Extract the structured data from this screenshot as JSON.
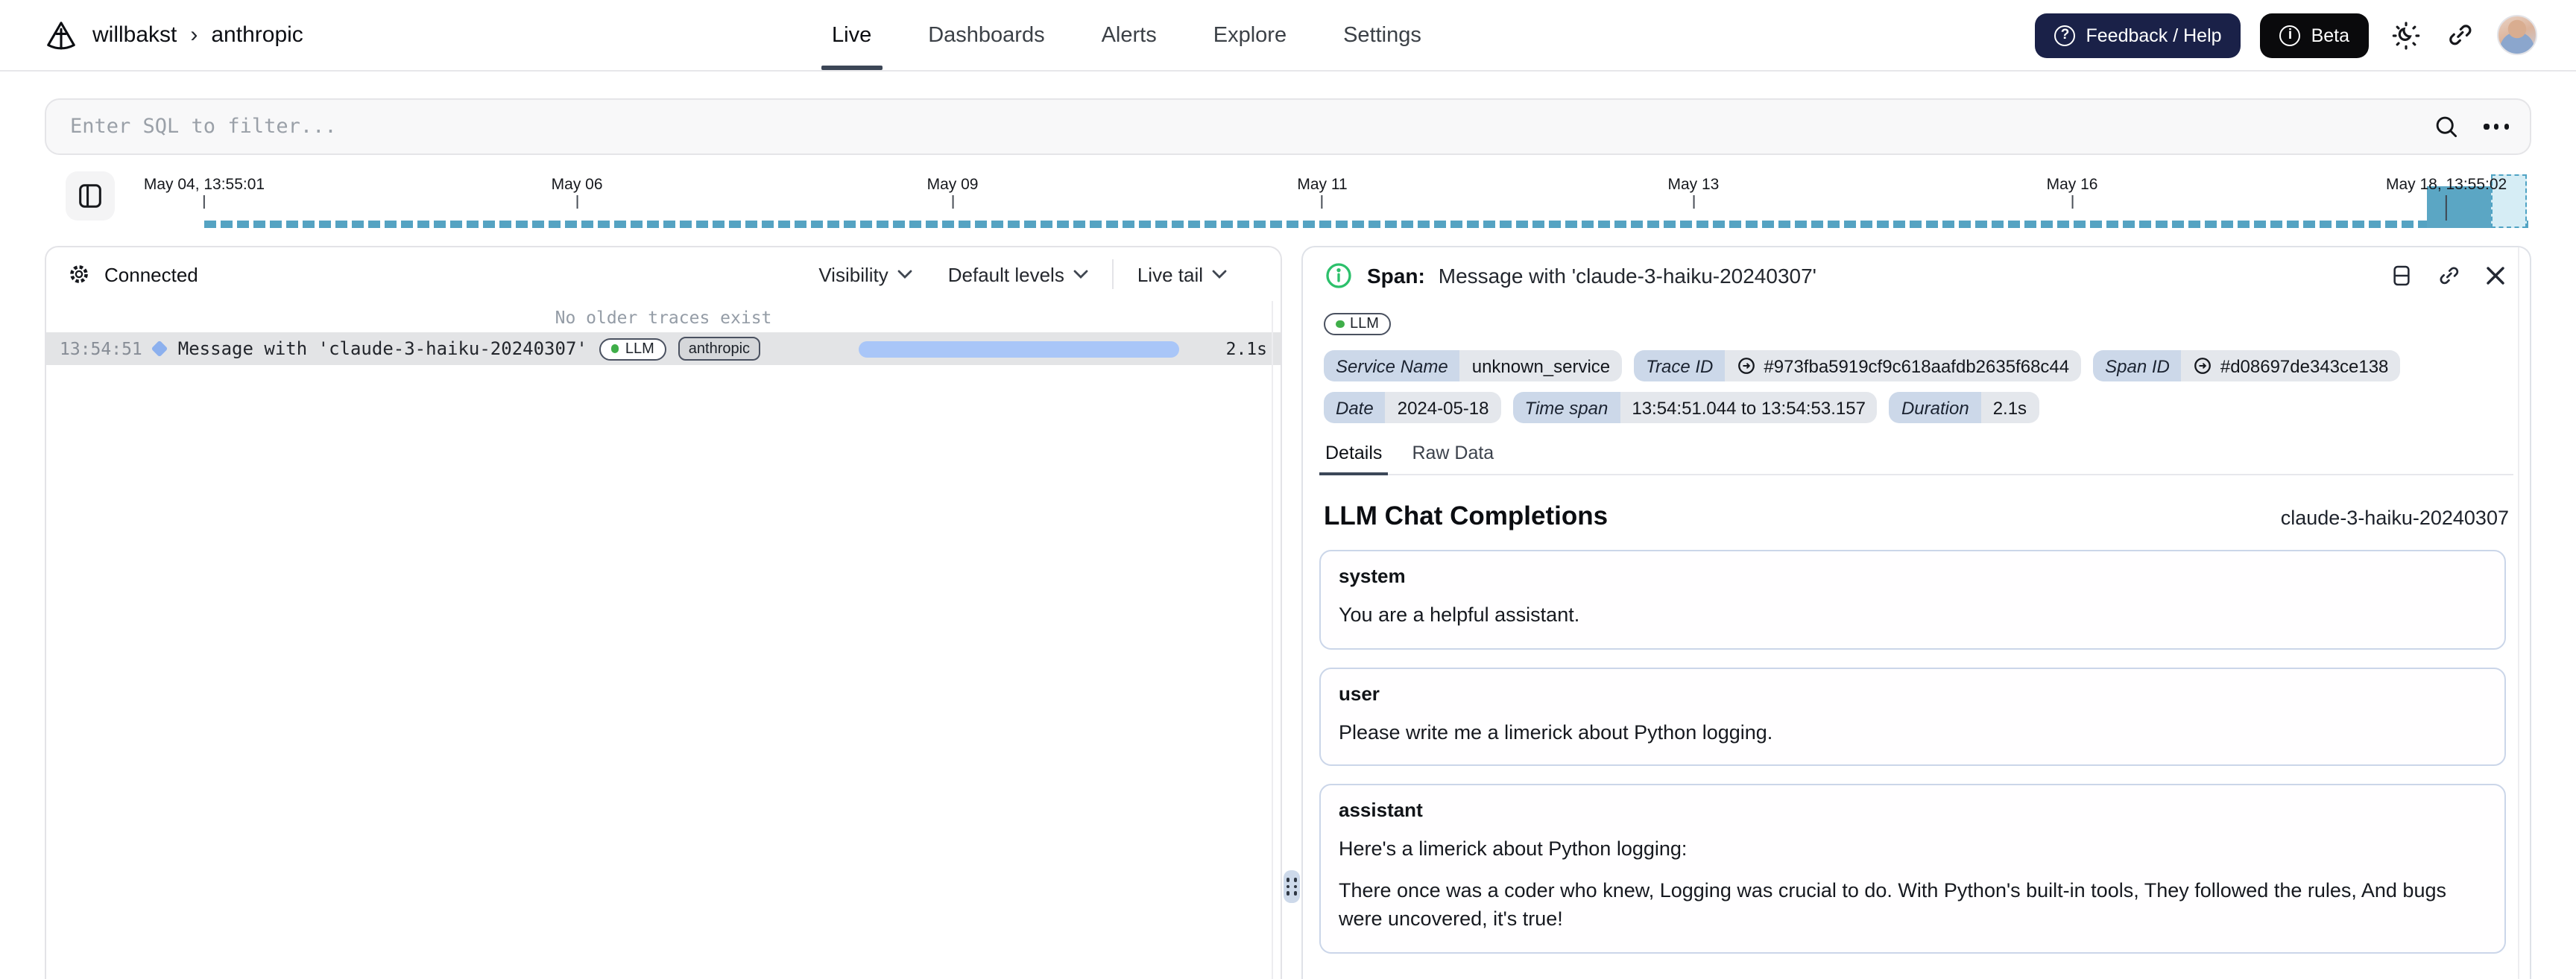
{
  "header": {
    "breadcrumb": {
      "org": "willbakst",
      "separator": "›",
      "project": "anthropic"
    },
    "tabs": [
      {
        "label": "Live",
        "active": true
      },
      {
        "label": "Dashboards",
        "active": false
      },
      {
        "label": "Alerts",
        "active": false
      },
      {
        "label": "Explore",
        "active": false
      },
      {
        "label": "Settings",
        "active": false
      }
    ],
    "feedback_label": "Feedback / Help",
    "feedback_glyph": "?",
    "beta_label": "Beta",
    "beta_glyph": "i"
  },
  "filter": {
    "placeholder": "Enter SQL to filter..."
  },
  "timeline": {
    "ticks": [
      "May 04, 13:55:01",
      "May 06",
      "May 09",
      "May 11",
      "May 13",
      "May 16",
      "May 18, 13:55:02"
    ]
  },
  "left_panel": {
    "status": "Connected",
    "visibility_label": "Visibility",
    "default_levels_label": "Default levels",
    "live_tail_label": "Live tail",
    "empty_message": "No older traces exist",
    "trace": {
      "time": "13:54:51",
      "title": "Message with 'claude-3-haiku-20240307'",
      "tag_llm": "LLM",
      "tag_project": "anthropic",
      "duration": "2.1s"
    }
  },
  "span_panel": {
    "kind_label": "Span:",
    "title": "Message with 'claude-3-haiku-20240307'",
    "tag_llm": "LLM",
    "meta": [
      {
        "label": "Service Name",
        "value": "unknown_service"
      },
      {
        "label": "Trace ID",
        "value": "#973fba5919cf9c618aafdb2635f68c44"
      },
      {
        "label": "Span ID",
        "value": "#d08697de343ce138"
      },
      {
        "label": "Date",
        "value": "2024-05-18"
      },
      {
        "label": "Time span",
        "value": "13:54:51.044 to 13:54:53.157"
      },
      {
        "label": "Duration",
        "value": "2.1s"
      }
    ],
    "tabs": [
      {
        "label": "Details",
        "active": true
      },
      {
        "label": "Raw Data",
        "active": false
      }
    ],
    "section_title": "LLM Chat Completions",
    "model": "claude-3-haiku-20240307",
    "messages": [
      {
        "role": "system",
        "paragraphs": [
          "You are a helpful assistant."
        ]
      },
      {
        "role": "user",
        "paragraphs": [
          "Please write me a limerick about Python logging."
        ]
      },
      {
        "role": "assistant",
        "paragraphs": [
          "Here's a limerick about Python logging:",
          "There once was a coder who knew, Logging was crucial to do. With Python's built-in tools, They followed the rules, And bugs were uncovered, it's true!"
        ]
      }
    ]
  },
  "colors": {
    "accent_navy": "#1a2148",
    "black": "#0a0a0c",
    "timeline_teal": "#55a3c2",
    "timeline_selection": "#d6edf5",
    "duration_bar_blue": "#a9c6f8",
    "status_green": "#3fae49",
    "info_green": "#2cc06b",
    "active_tab_underline": "#3c4656"
  }
}
